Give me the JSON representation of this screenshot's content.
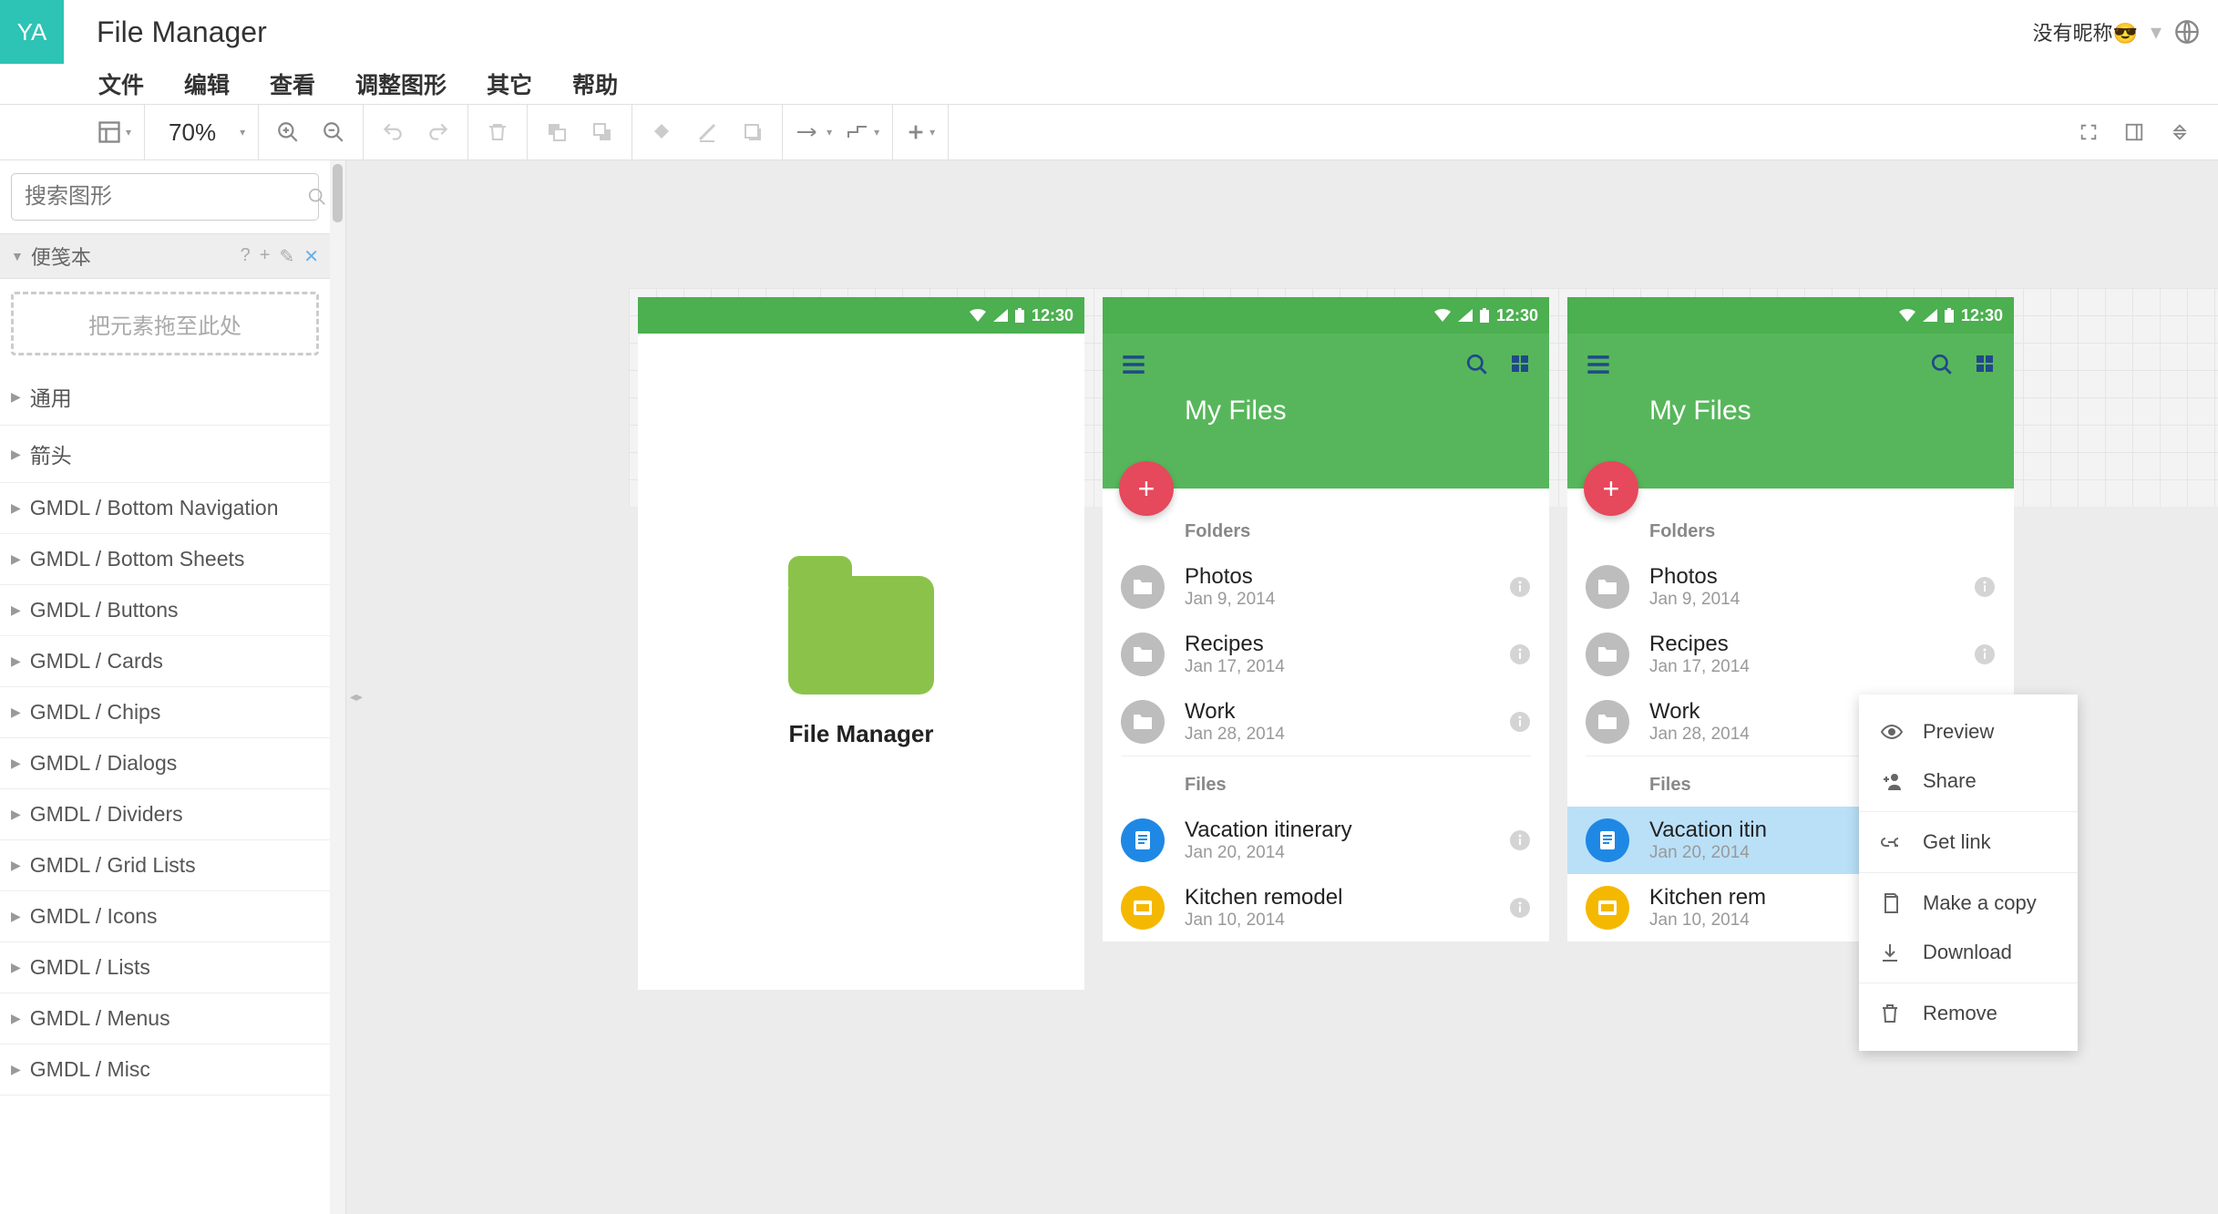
{
  "header": {
    "avatar": "YA",
    "title": "File Manager",
    "nickname": "没有昵称😎"
  },
  "menu": {
    "file": "文件",
    "edit": "编辑",
    "view": "查看",
    "adjust": "调整图形",
    "other": "其它",
    "help": "帮助"
  },
  "toolbar": {
    "zoom": "70%"
  },
  "sidebar": {
    "search_placeholder": "搜索图形",
    "scratchpad_title": "便笺本",
    "drop_hint": "把元素拖至此处",
    "categories": [
      "通用",
      "箭头",
      "GMDL / Bottom Navigation",
      "GMDL / Bottom Sheets",
      "GMDL / Buttons",
      "GMDL / Cards",
      "GMDL / Chips",
      "GMDL / Dialogs",
      "GMDL / Dividers",
      "GMDL / Grid Lists",
      "GMDL / Icons",
      "GMDL / Lists",
      "GMDL / Menus",
      "GMDL / Misc"
    ]
  },
  "status_time": "12:30",
  "mock": {
    "app_title": "My Files",
    "folders_label": "Folders",
    "files_label": "Files",
    "splash_caption": "File Manager",
    "folders": [
      {
        "name": "Photos",
        "date": "Jan 9, 2014"
      },
      {
        "name": "Recipes",
        "date": "Jan 17, 2014"
      },
      {
        "name": "Work",
        "date": "Jan 28, 2014"
      }
    ],
    "files": [
      {
        "name": "Vacation itinerary",
        "date": "Jan 20, 2014",
        "type": "doc"
      },
      {
        "name": "Kitchen remodel",
        "date": "Jan 10, 2014",
        "type": "slide"
      }
    ],
    "files3": [
      {
        "name": "Vacation itin",
        "date": "Jan 20, 2014",
        "type": "doc"
      },
      {
        "name": "Kitchen rem",
        "date": "Jan 10, 2014",
        "type": "slide"
      }
    ]
  },
  "ctx": {
    "preview": "Preview",
    "share": "Share",
    "getlink": "Get link",
    "copy": "Make a copy",
    "download": "Download",
    "remove": "Remove"
  }
}
